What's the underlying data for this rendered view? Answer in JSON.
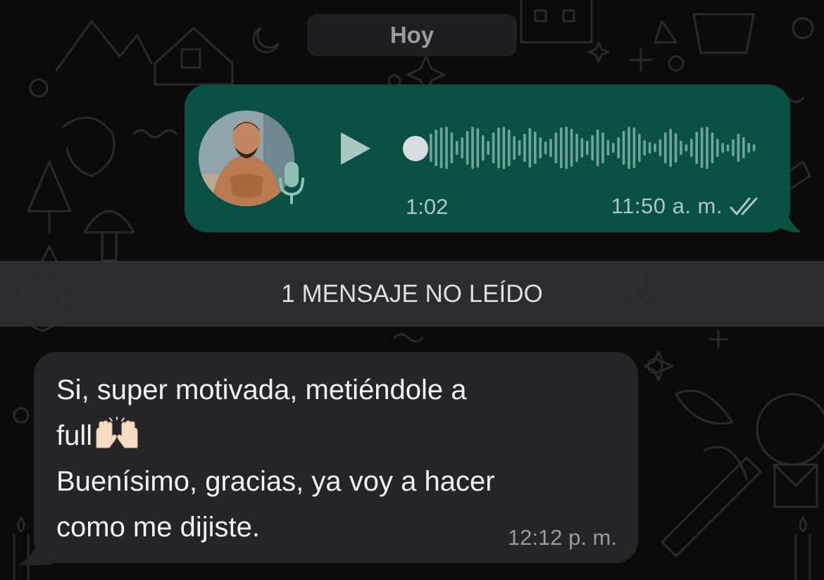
{
  "date_chip": {
    "label": "Hoy"
  },
  "voice_message": {
    "duration": "1:02",
    "time": "11:50 a. m.",
    "status_icon": "double-check-icon",
    "colors": {
      "bubble": "#0a5144",
      "accent": "#a9c8c0"
    }
  },
  "unread_banner": {
    "label": "1 MENSAJE NO LEÍDO"
  },
  "incoming_message": {
    "lines": [
      "Si, super motivada, metiéndole a",
      "full🙌",
      "Buenísimo, gracias, ya voy a hacer",
      "como me dijiste."
    ],
    "line1": "Si, super motivada, metiéndole a",
    "line2": "full",
    "line3": "Buenísimo, gracias, ya voy a hacer",
    "line4": "como me dijiste.",
    "emoji": "raising-hands-icon",
    "time": "12:12 p. m.",
    "colors": {
      "bubble": "#252527",
      "text": "#f2f2f4"
    }
  }
}
